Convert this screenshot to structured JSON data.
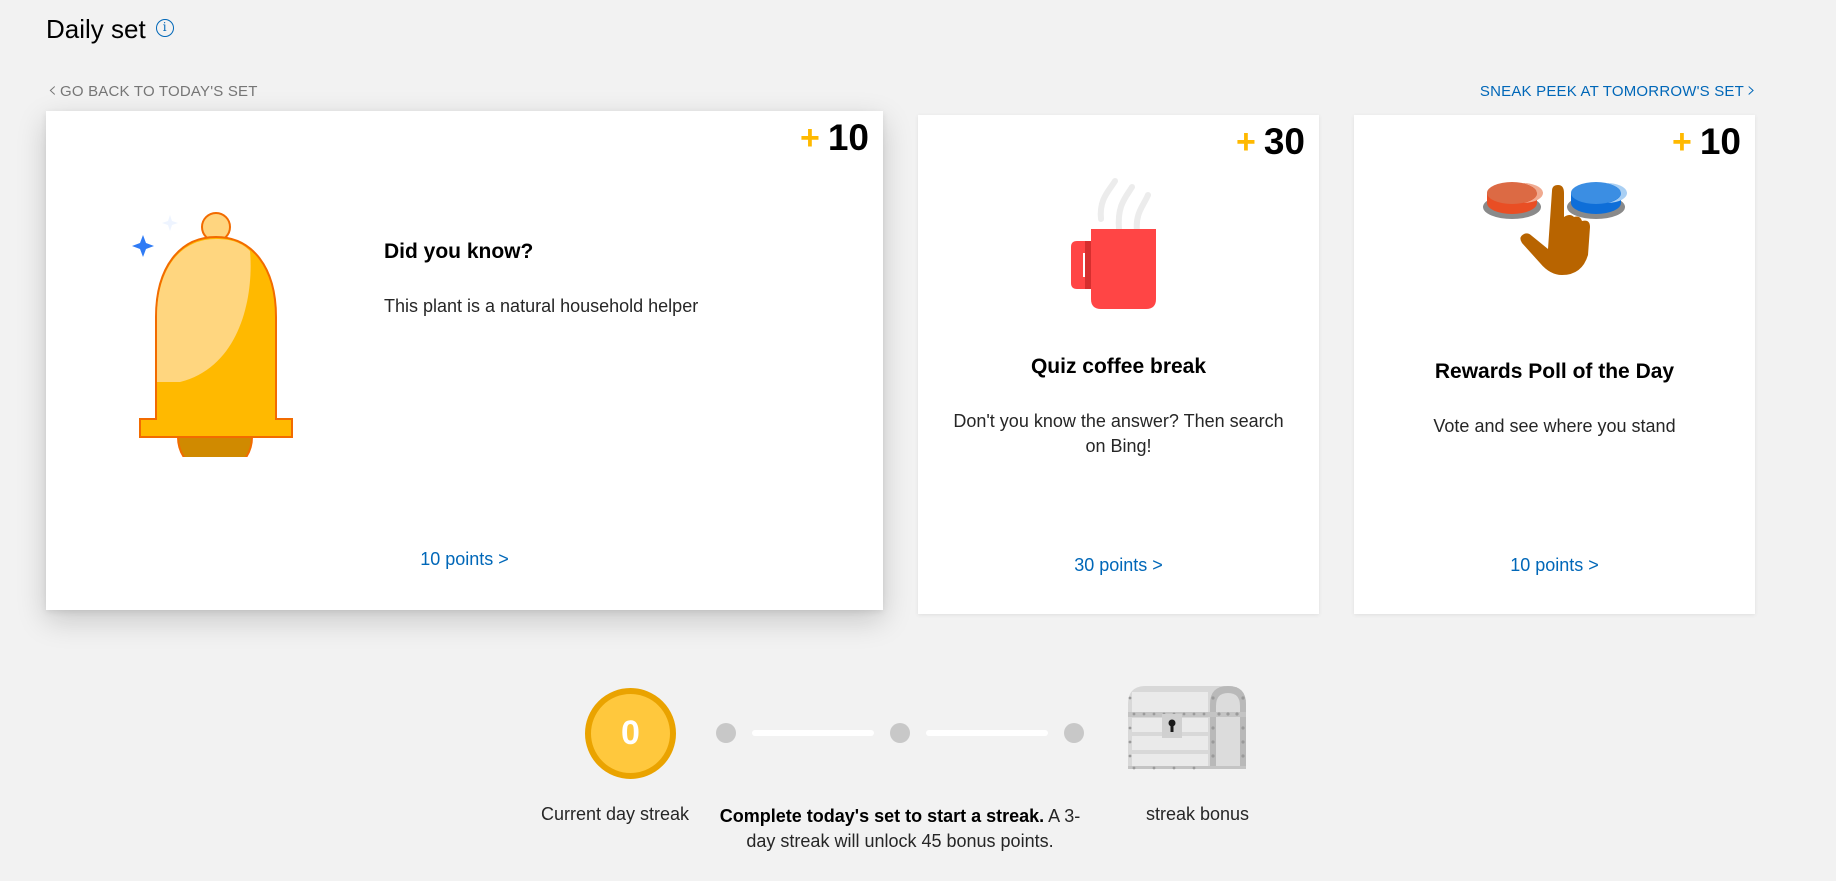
{
  "header": {
    "title": "Daily set",
    "info_icon": "i"
  },
  "nav": {
    "back_label": "GO BACK TO TODAY'S SET",
    "back_icon": "‹",
    "next_label": "SNEAK PEEK AT TOMORROW'S SET",
    "next_icon": "›"
  },
  "cards": [
    {
      "icon": "bell-icon",
      "badge_plus": "+",
      "badge_points": "10",
      "heading": "Did you know?",
      "body": "This plant is a natural household helper",
      "link": "10 points >"
    },
    {
      "icon": "coffee-mug-icon",
      "badge_plus": "+",
      "badge_points": "30",
      "heading": "Quiz coffee break",
      "body": "Don't you know the answer? Then search on Bing!",
      "link": "30 points >"
    },
    {
      "icon": "poll-buttons-icon",
      "badge_plus": "+",
      "badge_points": "10",
      "heading": "Rewards Poll of the Day",
      "body": "Vote and see where you stand",
      "link": "10 points >"
    }
  ],
  "streak": {
    "current_count": "0",
    "current_label": "Current day streak",
    "desc_bold": "Complete today's set to start a streak.",
    "desc_rest": " A 3-day streak will unlock 45 bonus points.",
    "bonus_label": "streak bonus",
    "progress_days_completed": 0,
    "progress_days_total": 3
  },
  "colors": {
    "accent_blue": "#0067b8",
    "badge_plus_yellow": "#ffb900",
    "coin_fill": "#ffc83d",
    "coin_ring": "#eaa300",
    "background": "#f2f2f2"
  }
}
